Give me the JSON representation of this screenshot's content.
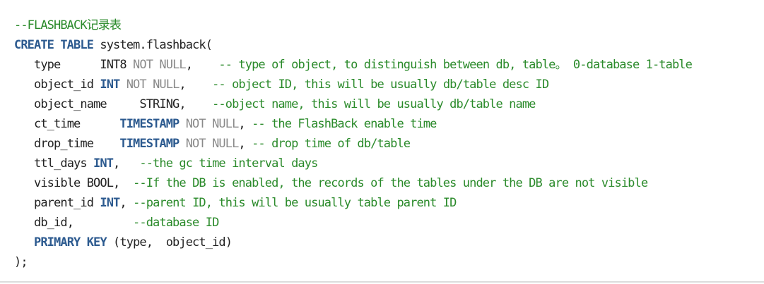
{
  "colors": {
    "keyword": "#2c5a8f",
    "comment": "#2a8a2a",
    "constraint": "#8a8a8a",
    "text": "#222222",
    "background": "#ffffff"
  },
  "code": {
    "header_comment": "--FLASHBACK记录表",
    "create": {
      "kw": "CREATE TABLE",
      "rest": " system.flashback("
    },
    "lines": [
      {
        "indent": "   ",
        "name": "type      ",
        "type_plain": "INT8",
        "type_kw": "",
        "constraint": " NOT NULL",
        "punct": ",    ",
        "comment": "-- type of object, to distinguish between db, table。 0-database 1-table"
      },
      {
        "indent": "   ",
        "name": "object_id ",
        "type_plain": "",
        "type_kw": "INT",
        "constraint": " NOT NULL",
        "punct": ",    ",
        "comment": "-- object ID, this will be usually db/table desc ID"
      },
      {
        "indent": "   ",
        "name": "object_name     ",
        "type_plain": "STRING",
        "type_kw": "",
        "constraint": "",
        "punct": ",    ",
        "comment": "--object name, this will be usually db/table name"
      },
      {
        "indent": "   ",
        "name": "ct_time      ",
        "type_plain": "",
        "type_kw": "TIMESTAMP",
        "constraint": " NOT NULL",
        "punct": ", ",
        "comment": "-- the FlashBack enable time"
      },
      {
        "indent": "   ",
        "name": "drop_time    ",
        "type_plain": "",
        "type_kw": "TIMESTAMP",
        "constraint": " NOT NULL",
        "punct": ", ",
        "comment": "-- drop time of db/table"
      },
      {
        "indent": "   ",
        "name": "ttl_days ",
        "type_plain": "",
        "type_kw": "INT",
        "constraint": "",
        "punct": ",   ",
        "comment": "--the gc time interval days"
      },
      {
        "indent": "   ",
        "name": "visible ",
        "type_plain": "BOOL",
        "type_kw": "",
        "constraint": "",
        "punct": ",  ",
        "comment": "--If the DB is enabled, the records of the tables under the DB are not visible"
      },
      {
        "indent": "   ",
        "name": "parent_id ",
        "type_plain": "",
        "type_kw": "INT",
        "constraint": "",
        "punct": ", ",
        "comment": "--parent ID, this will be usually table parent ID"
      },
      {
        "indent": "   ",
        "name": "db_id,         ",
        "type_plain": "",
        "type_kw": "",
        "constraint": "",
        "punct": "",
        "comment": "--database ID"
      }
    ],
    "primary_key": {
      "indent": "   ",
      "kw": "PRIMARY KEY",
      "rest": " (type,  object_id)"
    },
    "close": ");"
  }
}
